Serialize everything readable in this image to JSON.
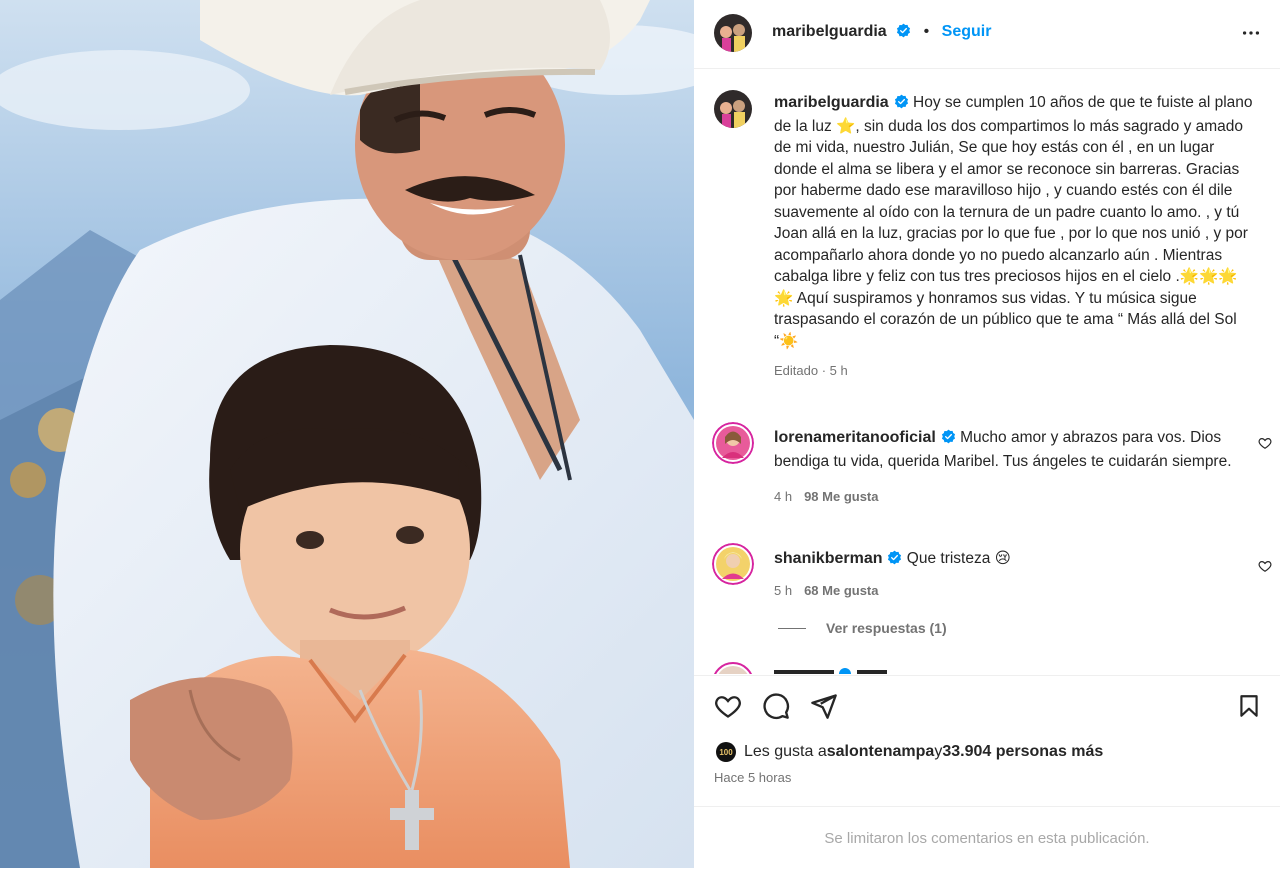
{
  "post": {
    "username": "maribelguardia",
    "follow_label": "Seguir",
    "separator": "•",
    "caption": "Hoy se cumplen 10 años de que te fuiste al plano de la luz ⭐, sin duda los dos compartimos lo más sagrado y amado de mi vida, nuestro Julián, Se que hoy estás con él , en un lugar donde el alma se libera y el amor se reconoce sin barreras. Gracias por haberme dado ese maravilloso hijo , y cuando estés con él dile suavemente al oído con la ternura de un padre cuanto lo amo. , y tú Joan allá en la luz, gracias por lo que fue , por lo que nos unió , y por acompañarlo ahora donde yo no puedo alcanzarlo aún . Mientras cabalga libre y feliz con tus tres preciosos hijos en el cielo .🌟🌟🌟🌟 Aquí suspiramos y honramos sus vidas. Y tu música sigue traspasando el corazón de un público que te ama “ Más allá del Sol “☀️",
    "caption_meta": "Editado · 5 h"
  },
  "comments": [
    {
      "username": "lorenameritanooficial",
      "text": "Mucho amor y abrazos para vos. Dios bendiga tu vida, querida Maribel. Tus ángeles te cuidarán siempre.",
      "time": "4 h",
      "likes": "98 Me gusta"
    },
    {
      "username": "shanikberman",
      "text": "Que tristeza 😢",
      "time": "5 h",
      "likes": "68 Me gusta"
    }
  ],
  "view_replies": "Ver respuestas (1)",
  "likes_line": {
    "prefix": "Les gusta a ",
    "user": "salontenampa",
    "middle": " y ",
    "count": "33.904 personas más",
    "badge": "100"
  },
  "posted_time": "Hace 5 horas",
  "comments_limited": "Se limitaron los comentarios en esta publicación.",
  "colors": {
    "link_blue": "#0095f6",
    "verified_blue": "#0095f6",
    "muted": "#737373"
  }
}
